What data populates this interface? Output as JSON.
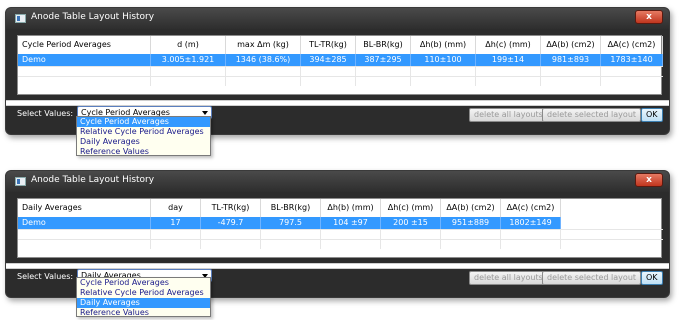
{
  "windows": [
    {
      "title": "Anode Table Layout History",
      "close_label": "x",
      "columns": [
        "Cycle Period Averages",
        "d (m)",
        "max Δm (kg)",
        "TL-TR(kg)",
        "BL-BR(kg)",
        "Δh(b) (mm)",
        "Δh(c) (mm)",
        "ΔA(b) (cm2)",
        "ΔA(c) (cm2)"
      ],
      "row": [
        "Demo",
        "3.005±1.921",
        "1346 (38.6%)",
        "394±285",
        "387±295",
        "110±100",
        "199±14",
        "981±893",
        "1783±140"
      ],
      "select_label": "Select Values:",
      "select_value": "Cycle Period Averages",
      "buttons": {
        "delete_all": "delete all layouts",
        "delete_selected": "delete selected layout",
        "ok": "OK"
      },
      "options": [
        "Cycle Period Averages",
        "Relative Cycle Period Averages",
        "Daily Averages",
        "Reference Values"
      ],
      "selected_option": 0
    },
    {
      "title": "Anode Table Layout History",
      "close_label": "x",
      "columns": [
        "Daily Averages",
        "day",
        "TL-TR(kg)",
        "BL-BR(kg)",
        "Δh(b) (mm)",
        "Δh(c) (mm)",
        "ΔA(b) (cm2)",
        "ΔA(c) (cm2)"
      ],
      "row": [
        "Demo",
        "17",
        "-479.7",
        "797.5",
        "104 ±97",
        "200 ±15",
        "951±889",
        "1802±149"
      ],
      "select_label": "Select Values:",
      "select_value": "Daily Averages",
      "buttons": {
        "delete_all": "delete all layouts",
        "delete_selected": "delete selected layout",
        "ok": "OK"
      },
      "options": [
        "Cycle Period Averages",
        "Relative Cycle Period Averages",
        "Daily Averages",
        "Reference Values"
      ],
      "selected_option": 2
    }
  ],
  "colors": {
    "selection": "#3399ff",
    "window_bg": "#2c2c2c",
    "close_button": "#c0351e"
  }
}
